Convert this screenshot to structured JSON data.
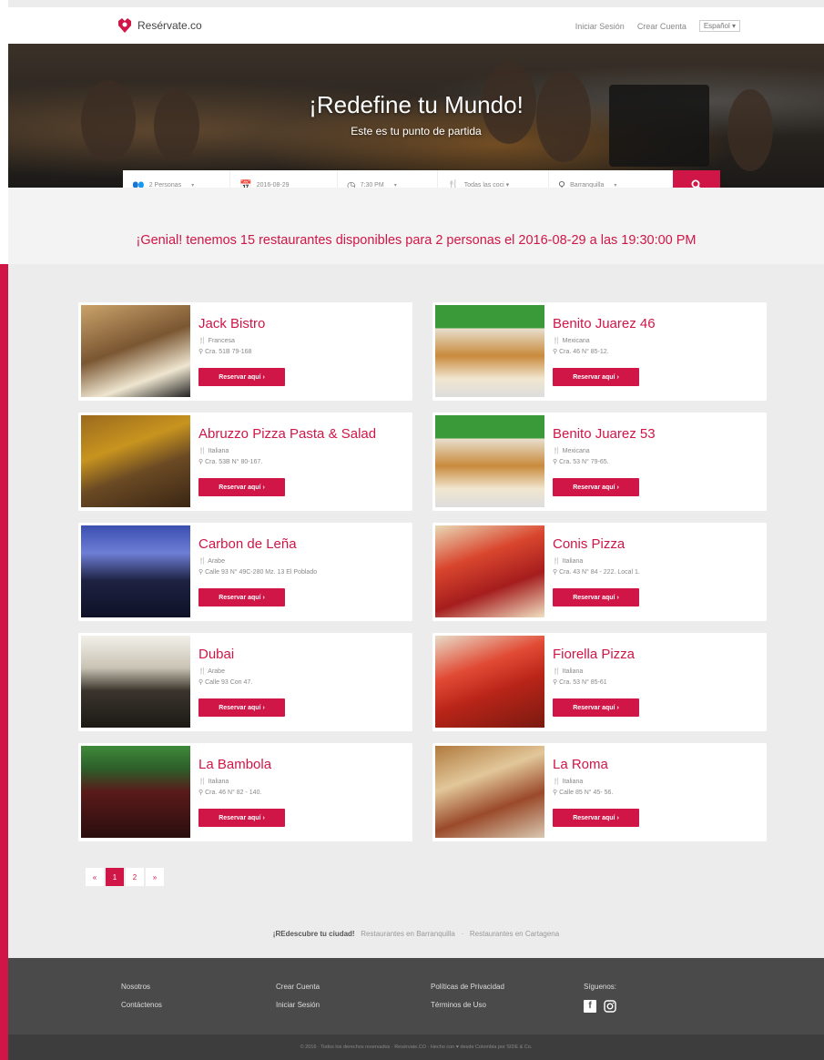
{
  "header": {
    "logo_text": "Resérvate.co",
    "nav": {
      "login": "Iniciar Sesión",
      "signup": "Crear Cuenta",
      "language": "Español ▾"
    }
  },
  "hero": {
    "title": "¡Redefine tu Mundo!",
    "subtitle": "Este es tu punto de partida"
  },
  "search": {
    "people": "2 Personas",
    "date": "2016-08-29",
    "time": "7:30 PM",
    "cuisine": "Todas las coci ▾",
    "city": "Barranquilla"
  },
  "availability": "¡Genial! tenemos 15 restaurantes disponibles para 2 personas el 2016-08-29 a las 19:30:00 PM",
  "restaurants": [
    {
      "name": "Jack Bistro",
      "cuisine": "Francesa",
      "address": "Cra. 51B 79-168",
      "button": "Reservar aquí ›"
    },
    {
      "name": "Benito Juarez 46",
      "cuisine": "Mexicana",
      "address": "Cra. 46 N° 85-12.",
      "button": "Reservar aquí ›"
    },
    {
      "name": "Abruzzo Pizza Pasta & Salad",
      "cuisine": "Italiana",
      "address": "Cra. 53B N° 80-167.",
      "button": "Reservar aquí ›"
    },
    {
      "name": "Benito Juarez 53",
      "cuisine": "Mexicana",
      "address": "Cra. 53 N° 79-65.",
      "button": "Reservar aquí ›"
    },
    {
      "name": "Carbon de Leña",
      "cuisine": "Arabe",
      "address": "Calle 93 N° 49C-280 Mz. 13 El Poblado",
      "button": "Reservar aquí ›"
    },
    {
      "name": "Conis Pizza",
      "cuisine": "Italiana",
      "address": "Cra. 43 N° 84 - 222. Local 1.",
      "button": "Reservar aquí ›"
    },
    {
      "name": "Dubai",
      "cuisine": "Arabe",
      "address": "Calle 93 Con 47.",
      "button": "Reservar aquí ›"
    },
    {
      "name": "Fiorella Pizza",
      "cuisine": "Italiana",
      "address": "Cra. 53 N° 85-61",
      "button": "Reservar aquí ›"
    },
    {
      "name": "La Bambola",
      "cuisine": "Italiana",
      "address": "Cra. 46 N° 82 - 140.",
      "button": "Reservar aquí ›"
    },
    {
      "name": "La Roma",
      "cuisine": "Italiana",
      "address": "Calle 85 N° 45- 56.",
      "button": "Reservar aquí ›"
    }
  ],
  "pagination": {
    "prev": "«",
    "pages": [
      "1",
      "2"
    ],
    "next": "»",
    "current": "1"
  },
  "rediscover": {
    "label": "¡REdescubre tu ciudad!",
    "link1": "Restaurantes en Barranquilla",
    "sep": "·",
    "link2": "Restaurantes en Cartagena"
  },
  "footer": {
    "col1": [
      "Nosotros",
      "Contáctenos"
    ],
    "col2": [
      "Crear Cuenta",
      "Iniciar Sesión"
    ],
    "col3": [
      "Políticas de Privacidad",
      "Términos de Uso"
    ],
    "social_title": "Síguenos:",
    "copyright": "© 2016 · Todos los derechos reservados · Resérvate.CO · Hecho con ♥ desde Colombia por SIDE & Co."
  },
  "colors": {
    "accent": "#d01647",
    "footer": "#4a4a4a",
    "page_bg": "#ececec"
  }
}
